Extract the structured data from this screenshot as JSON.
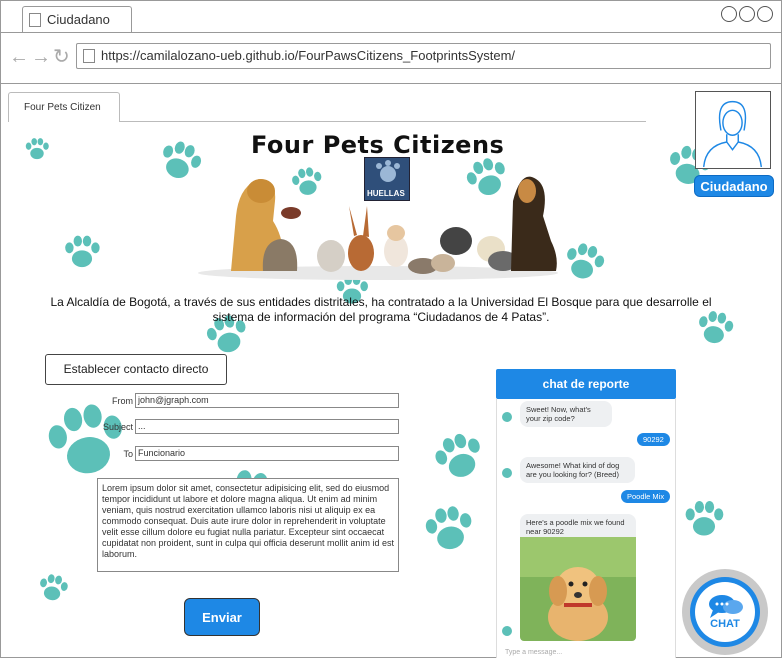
{
  "browser": {
    "tab_title": "Ciudadano",
    "url": "https://camilalozano-ueb.github.io/FourPawsCitizens_FootprintsSystem/"
  },
  "page_tab": {
    "label": "Four Pets Citizen"
  },
  "header": {
    "title": "Four Pets Citizens",
    "logo_text": "HUELLAS"
  },
  "intro_text": "La Alcaldía de Bogotá, a través de sus entidades distritales, ha contratado a la Universidad El Bosque para que desarrolle el sistema de información del programa “Ciudadanos de 4 Patas”.",
  "user": {
    "role_label": "Ciudadano"
  },
  "contact_form": {
    "button_label": "Establecer contacto directo",
    "from_label": "From",
    "from_value": "john@jgraph.com",
    "subject_label": "Subject",
    "subject_value": "...",
    "to_label": "To",
    "to_value": "Funcionario",
    "message": "Lorem ipsum dolor sit amet, consectetur adipisicing elit, sed do eiusmod tempor incididunt ut labore et dolore magna aliqua. Ut enim ad minim veniam, quis nostrud exercitation ullamco laboris nisi ut aliquip ex ea commodo consequat. Duis aute irure dolor in reprehenderit in voluptate velit esse cillum dolore eu fugiat nulla pariatur. Excepteur sint occaecat cupidatat non proident, sunt in culpa qui officia deserunt mollit anim id est laborum.",
    "send_label": "Enviar"
  },
  "chat": {
    "header": "chat de reporte",
    "messages": [
      {
        "from": "bot",
        "text": "Sweet! Now, what's your zip code?"
      },
      {
        "from": "user",
        "text": "90292"
      },
      {
        "from": "bot",
        "text": "Awesome! What kind of dog are you looking for? (Breed)"
      },
      {
        "from": "user",
        "text": "Poodle Mix"
      },
      {
        "from": "bot",
        "text": "Here's a poodle mix we found near 90292"
      }
    ],
    "input_placeholder": "Type a message...",
    "fab_label": "CHAT"
  },
  "colors": {
    "accent": "#1e88e5",
    "paw": "#5cc0b8"
  }
}
